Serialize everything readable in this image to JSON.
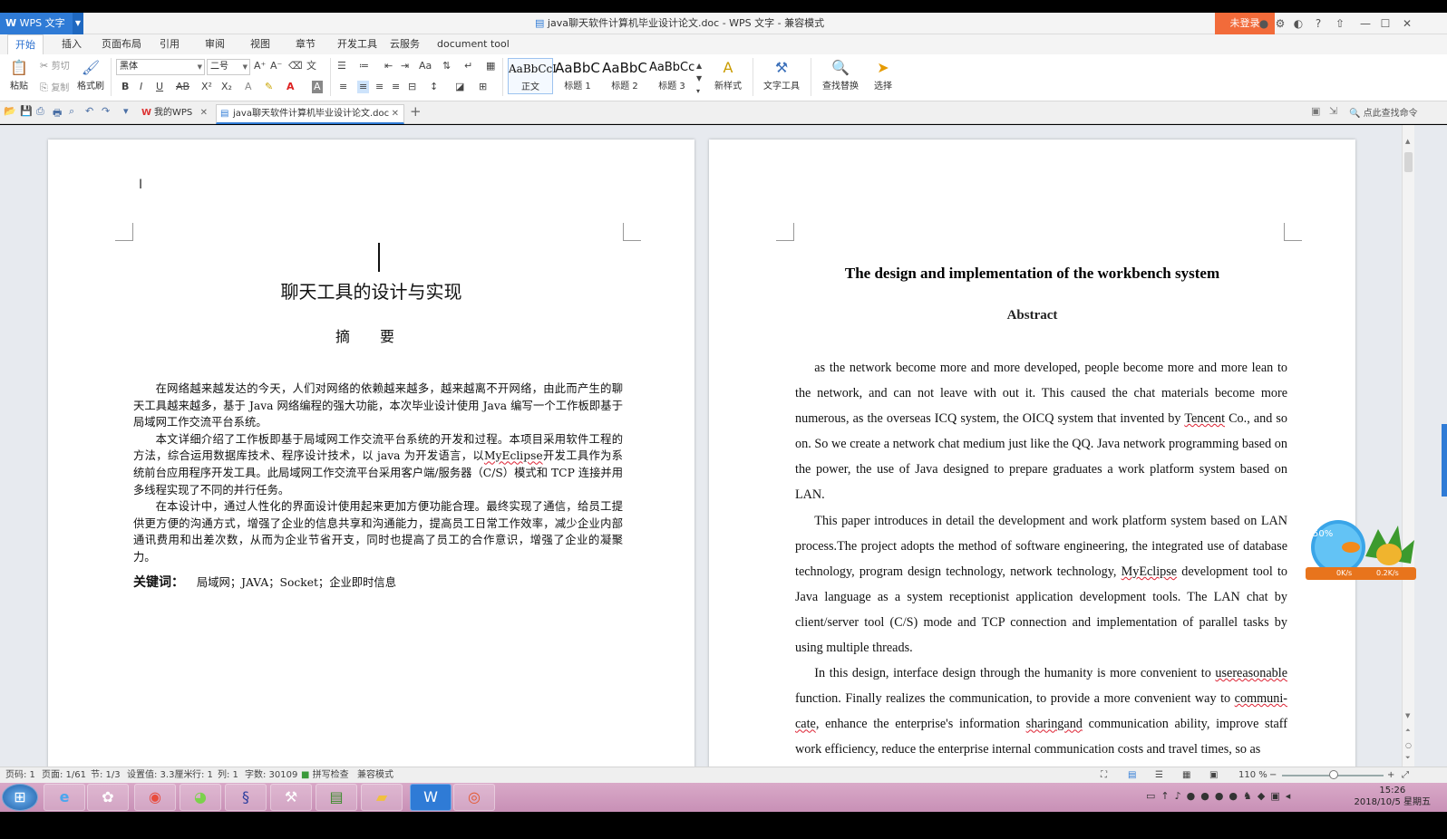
{
  "titlebar": {
    "app_name": "WPS 文字",
    "doc_title": "java聊天软件计算机毕业设计论文.doc - WPS 文字 - 兼容模式",
    "login_label": "未登录"
  },
  "menu": {
    "tabs": [
      "开始",
      "插入",
      "页面布局",
      "引用",
      "审阅",
      "视图",
      "章节",
      "开发工具",
      "云服务",
      "document tool"
    ]
  },
  "ribbon": {
    "paste": "粘贴",
    "cut": "剪切",
    "copy": "复制",
    "format_painter": "格式刷",
    "font_name": "黑体",
    "font_size": "二号",
    "styles": [
      {
        "sample": "AaBbCcI",
        "label": "正文"
      },
      {
        "sample": "AaBbC",
        "label": "标题 1"
      },
      {
        "sample": "AaBbC",
        "label": "标题 2"
      },
      {
        "sample": "AaBbCc",
        "label": "标题 3"
      }
    ],
    "new_style": "新样式",
    "text_tools": "文字工具",
    "find_replace": "查找替换",
    "select": "选择"
  },
  "tabbar": {
    "tab_mywps": "我的WPS",
    "tab_doc": "java聊天软件计算机毕业设计论文.doc",
    "search_cmd": "点此查找命令"
  },
  "page1": {
    "title": "聊天工具的设计与实现",
    "abstract_heading": "摘  要",
    "para1": "在网络越来越发达的今天，人们对网络的依赖越来越多，越来越离不开网络，由此而产生的聊天工具越来越多，基于 Java 网络编程的强大功能，本次毕业设计使用 Java 编写一个工作板即基于局域网工作交流平台系统。",
    "para2_pre": "本文详细介绍了工作板即基于局域网工作交流平台系统的开发和过程。本项目采用软件工程的方法，综合运用数据库技术、程序设计技术，以 java 为开发语言，以",
    "para2_myeclipse": "MyEclipse",
    "para2_post": "开发工具作为系统前台应用程序开发工具。此局域网工作交流平台采用客户端/服务器（C/S）模式和 TCP 连接并用多线程实现了不同的并行任务。",
    "para3": "在本设计中，通过人性化的界面设计使用起来更加方便功能合理。最终实现了通信，给员工提供更方便的沟通方式，增强了企业的信息共享和沟通能力，提高员工日常工作效率，减少企业内部通讯费用和出差次数，从而为企业节省开支，同时也提高了员工的合作意识，增强了企业的凝聚力。",
    "keywords_label": "关键词：",
    "keywords": "局域网；JAVA；Socket；企业即时信息"
  },
  "page2": {
    "title": "The design and implementation of the workbench system",
    "abstract_heading": "Abstract",
    "p1_a": "as the network become more and more developed, people become more and more lean to the network, and can not leave with out it. This caused the chat materials become more numerous, as the overseas ICQ system, the OICQ system that invented by ",
    "p1_tencent": "Tencent",
    "p1_b": " Co., and so on. So we create a network chat medium just like the QQ. Java network programming based on the power, the use of Java designed to prepare graduates a work platform system based on LAN.",
    "p2_a": "This paper introduces in detail the development and work platform system based on LAN process.The project adopts the method of software engineering, the integrated use of database technology, program design technology, network technology, ",
    "p2_myeclipse": "MyEclipse",
    "p2_b": " development tool to Java language as a system receptionist application development tools. The LAN chat by client/server tool (C/S) mode and TCP connection and implementation of parallel tasks by using multiple threads.",
    "p3_a": "In this design, interface design through the humanity is more convenient to ",
    "p3_userea": "usereasonable",
    "p3_b": " function. Finally realizes the communication, to provide a more convenient way to ",
    "p3_communi": "communi-cate",
    "p3_c": ", enhance the enterprise's information ",
    "p3_sharing": "sharingand",
    "p3_d": " communication ability, improve staff work efficiency, reduce the enterprise internal communication costs and travel times, so as"
  },
  "status": {
    "page_no": "页码: 1",
    "pages": "页面: 1/61",
    "section": "节: 1/3",
    "setting": "设置值: 3.3厘米",
    "row": "行: 1",
    "col": "列: 1",
    "words": "字数: 30109",
    "spell": "拼写检查",
    "compat": "兼容模式",
    "zoom": "110 %"
  },
  "widget": {
    "percent": "50%",
    "up": "0K/s",
    "down": "0.2K/s"
  },
  "clock": {
    "time": "15:26",
    "date": "2018/10/5 星期五"
  },
  "colors": {
    "accent": "#2f7bd6",
    "login": "#f26b3a",
    "taskbar": "#c890b6"
  }
}
